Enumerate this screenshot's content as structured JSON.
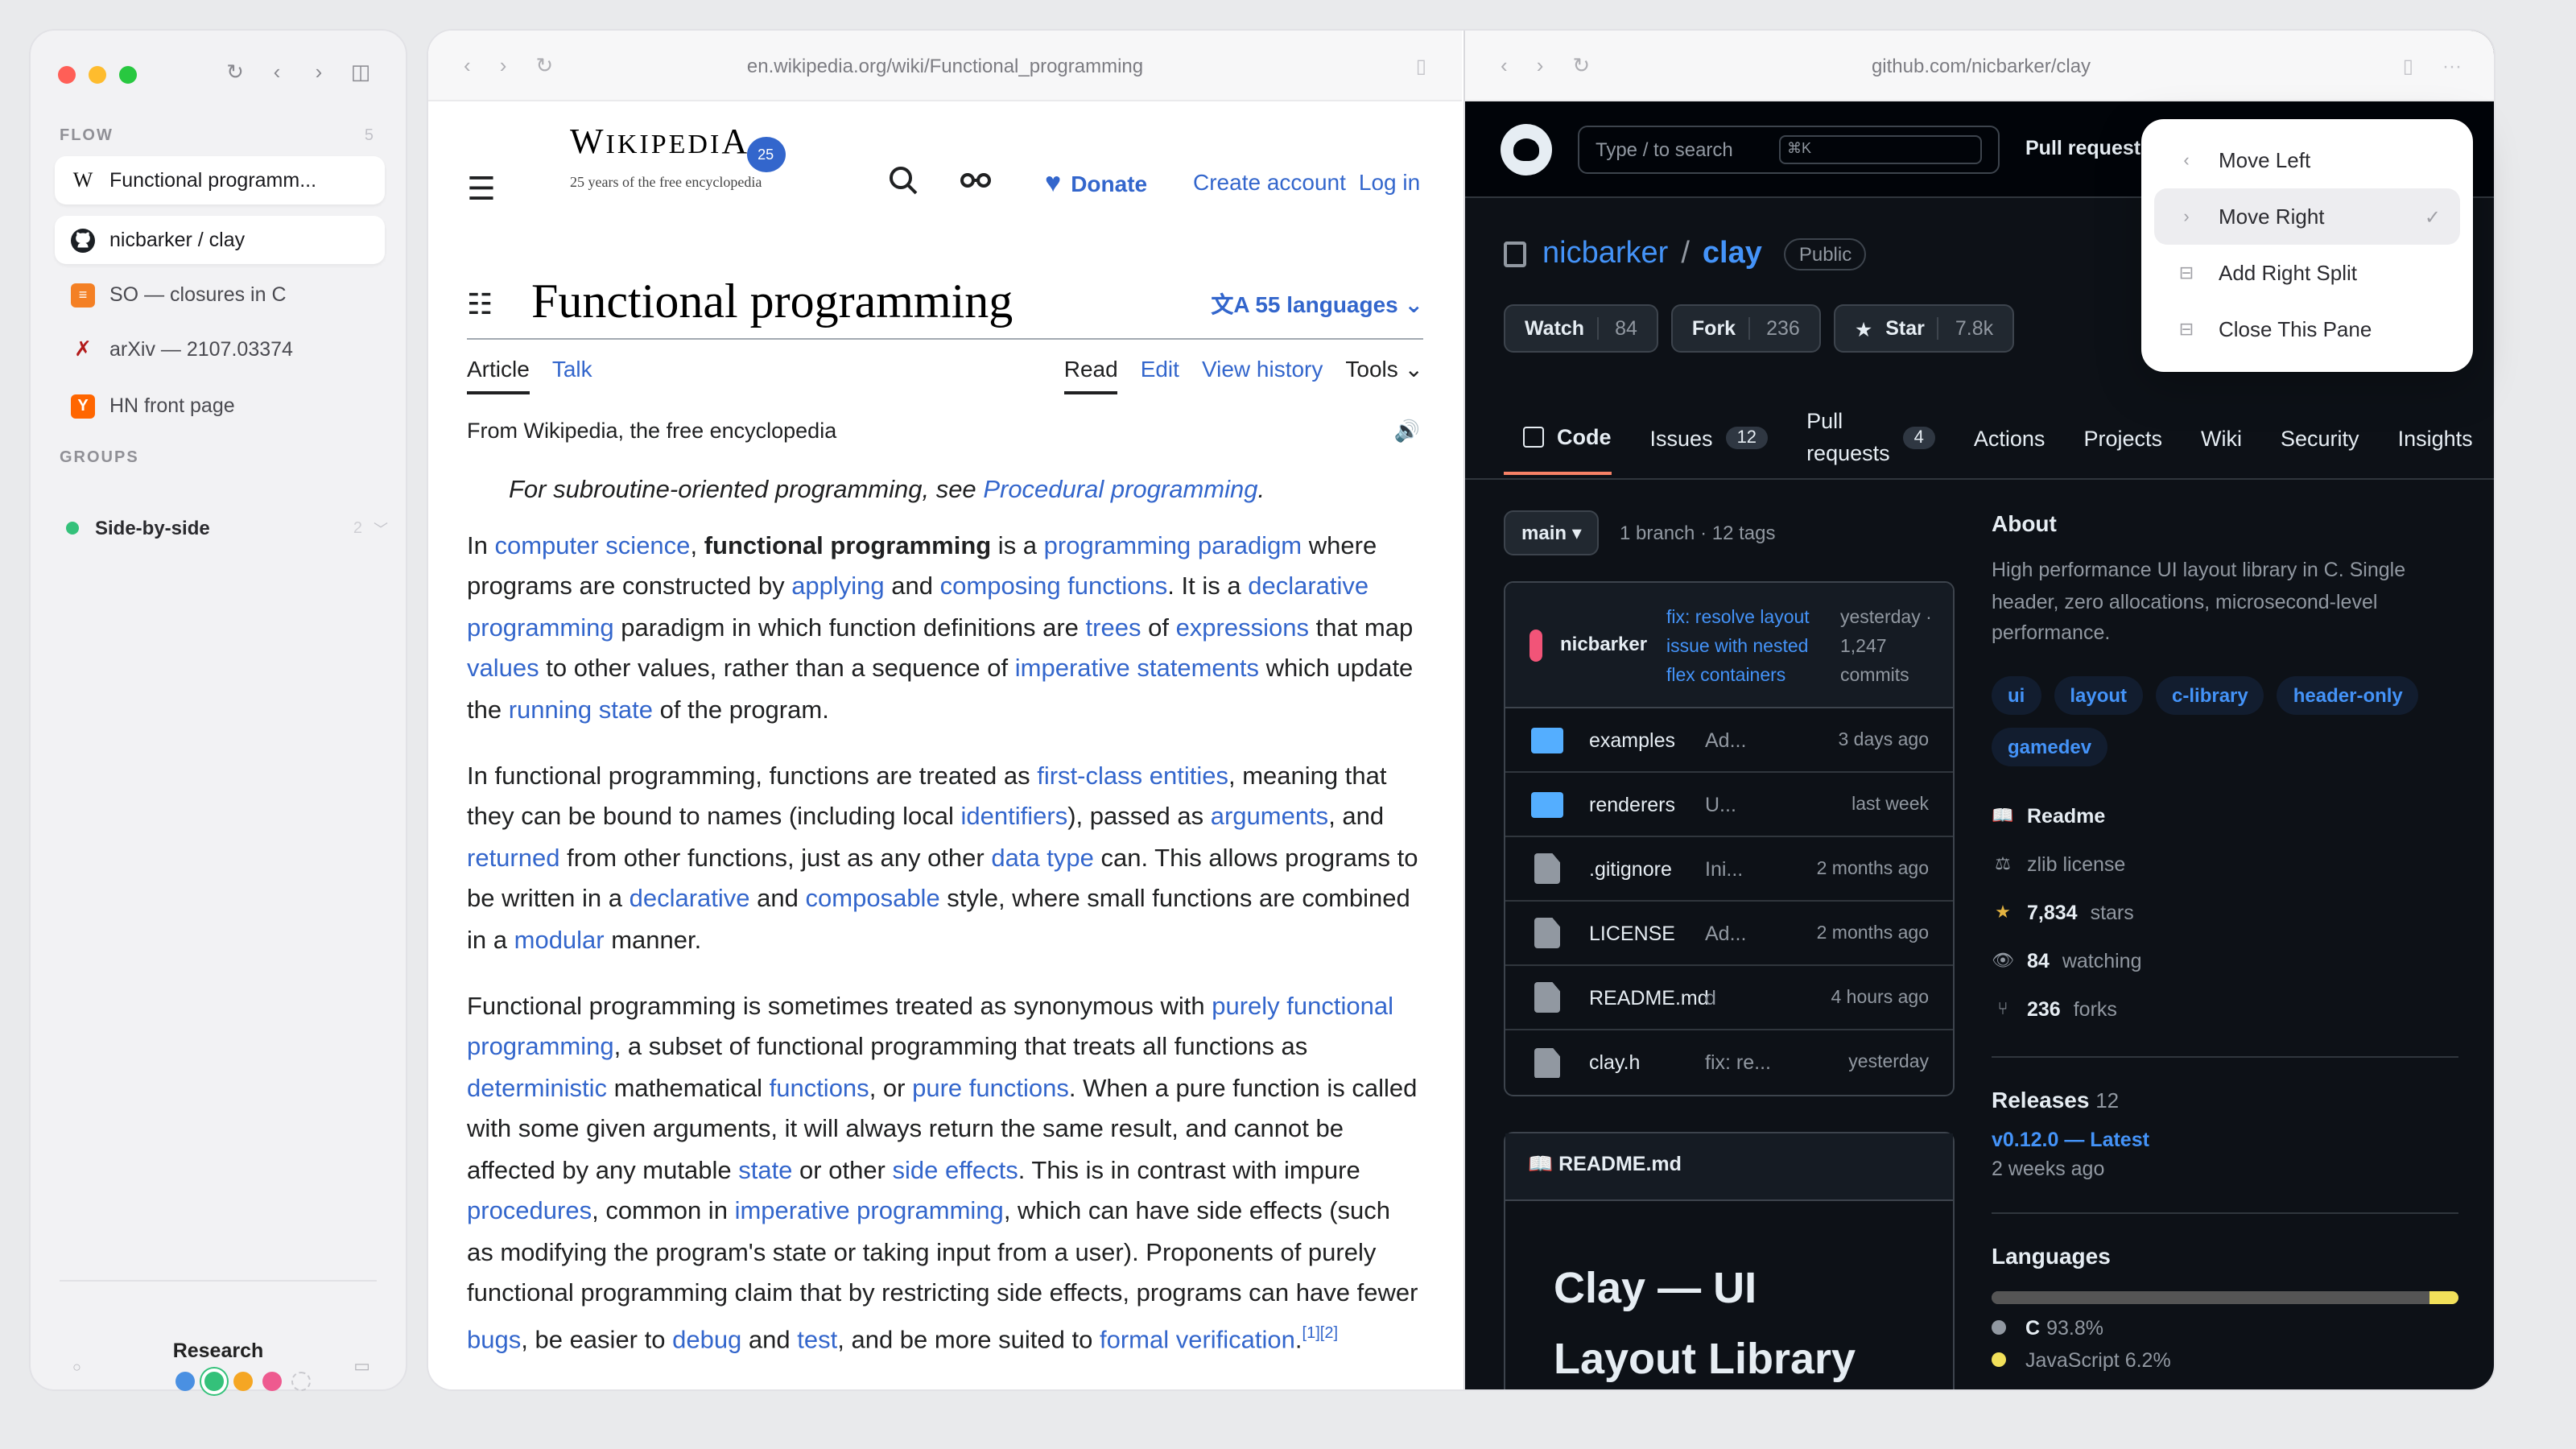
{
  "sidebar": {
    "traffic_lights": [
      "#ff5f57",
      "#febc2e",
      "#28c840"
    ],
    "nav_icons": [
      "refresh-icon",
      "back-icon",
      "forward-icon",
      "sidebar-toggle-icon"
    ],
    "section_flow": "FLOW",
    "flow_count": "5",
    "tabs": [
      {
        "label": "Functional programm...",
        "icon": "W",
        "active": true
      },
      {
        "label": "nicbarker / clay",
        "icon": "github",
        "active": true
      },
      {
        "label": "SO — closures in C",
        "icon": "so"
      },
      {
        "label": "arXiv — 2107.03374",
        "icon": "arxiv"
      },
      {
        "label": "HN front page",
        "icon": "Y"
      }
    ],
    "section_groups": "GROUPS",
    "groups": [
      {
        "label": "Side-by-side",
        "count": "2"
      }
    ],
    "workspace": {
      "title": "Research",
      "dots": [
        "#4a90e2",
        "#34c17a",
        "#f5a623",
        "#ee5a8f"
      ]
    }
  },
  "left_pane": {
    "url": "en.wikipedia.org/wiki/Functional_programming",
    "wiki": {
      "wordmark": "Wikipedia",
      "tagline": "25 years of the free encyclopedia",
      "donate": "Donate",
      "create_account": "Create account",
      "log_in": "Log in",
      "title": "Functional programming",
      "languages": "55 languages",
      "tab_article": "Article",
      "tab_talk": "Talk",
      "tab_read": "Read",
      "tab_edit": "Edit",
      "tab_history": "View history",
      "tab_tools": "Tools",
      "from": "From Wikipedia, the free encyclopedia",
      "hatnote_pre": "For subroutine-oriented programming, see ",
      "hatnote_link": "Procedural programming",
      "hatnote_post": "."
    }
  },
  "right_pane": {
    "url": "github.com/nicbarker/clay",
    "gh": {
      "search_placeholder": "Type / to search",
      "search_kbd": "⌘K",
      "pull_requests": "Pull requests",
      "owner": "nicbarker",
      "repo": "clay",
      "visibility": "Public",
      "watch": "Watch",
      "watch_count": "84",
      "fork": "Fork",
      "fork_count": "236",
      "star": "Star",
      "star_count": "7.8k",
      "nav": {
        "code": "Code",
        "issues": "Issues",
        "issues_count": "12",
        "pulls_1": "Pull",
        "pulls_2": "requests",
        "pulls_count": "4",
        "actions": "Actions",
        "projects": "Projects",
        "wiki": "Wiki",
        "security": "Security",
        "insights": "Insights"
      },
      "branch": "main",
      "branch_info": "1 branch · 12 tags",
      "commit": {
        "author": "nicbarker",
        "message": "fix: resolve layout issue with nested flex containers",
        "meta": "yesterday · 1,247 commits"
      },
      "files": [
        {
          "name": "examples",
          "type": "folder",
          "msg": "Ad...",
          "time": "3 days ago"
        },
        {
          "name": "renderers",
          "type": "folder",
          "msg": "U...",
          "time": "last week"
        },
        {
          "name": ".gitignore",
          "type": "file",
          "msg": "Ini...",
          "time": "2 months ago"
        },
        {
          "name": "LICENSE",
          "type": "file",
          "msg": "Ad...",
          "time": "2 months ago"
        },
        {
          "name": "README.md",
          "type": "file",
          "msg": "d",
          "time": "4 hours ago"
        },
        {
          "name": "clay.h",
          "type": "file",
          "msg": "fix: re...",
          "time": "yesterday"
        }
      ],
      "readme_label": "README.md",
      "readme_title": "Clay — UI Layout Library",
      "about": {
        "heading": "About",
        "description": "High performance UI layout library in C. Single header, zero allocations, microsecond-level performance.",
        "topics": [
          "ui",
          "layout",
          "c-library",
          "header-only",
          "gamedev"
        ],
        "readme": "Readme",
        "license": "zlib license",
        "stars": "7,834",
        "stars_label": "stars",
        "watching": "84",
        "watching_label": "watching",
        "forks": "236",
        "forks_label": "forks",
        "releases": "Releases",
        "releases_count": "12",
        "latest": "v0.12.0 — Latest",
        "latest_when": "2 weeks ago",
        "languages": "Languages",
        "lang_c": "C",
        "lang_c_pct": "93.8%",
        "lang_js": "JavaScript",
        "lang_js_pct": "6.2%",
        "lang_c_share": 93.8,
        "lang_js_share": 6.2,
        "lang_c_color": "#555555",
        "lang_js_color": "#f1e05a"
      }
    }
  },
  "context_menu": {
    "items": [
      {
        "label": "Move Left",
        "icon": "chevron-left-icon"
      },
      {
        "label": "Move Right",
        "icon": "chevron-right-icon",
        "checked": true
      },
      {
        "label": "Add Right Split",
        "icon": "split-icon"
      },
      {
        "label": "Close This Pane",
        "icon": "close-pane-icon"
      }
    ]
  }
}
